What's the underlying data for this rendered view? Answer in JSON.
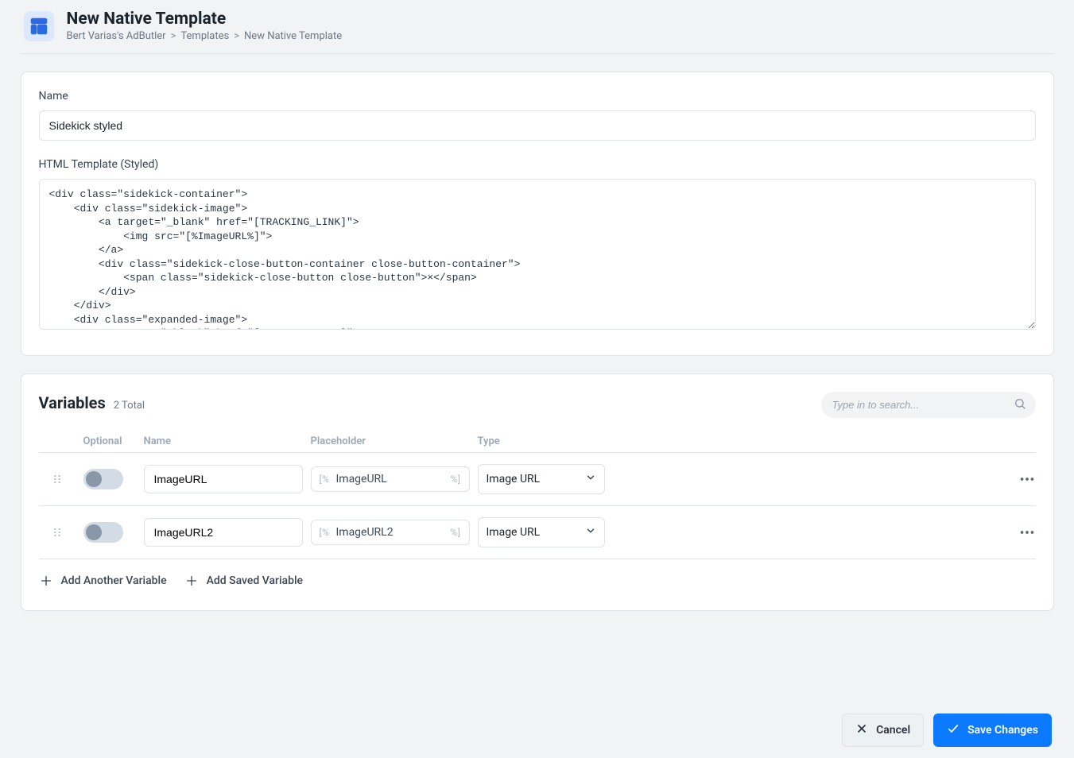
{
  "header": {
    "title": "New Native Template",
    "icon": "template-icon",
    "breadcrumb": [
      "Bert Varias's AdButler",
      "Templates",
      "New Native Template"
    ]
  },
  "form": {
    "name_label": "Name",
    "name_value": "Sidekick styled",
    "html_label": "HTML Template (Styled)",
    "html_value": "<div class=\"sidekick-container\">\n    <div class=\"sidekick-image\">\n        <a target=\"_blank\" href=\"[TRACKING_LINK]\">\n            <img src=\"[%ImageURL%]\">\n        </a>\n        <div class=\"sidekick-close-button-container close-button-container\">\n            <span class=\"sidekick-close-button close-button\">×</span>\n        </div>\n    </div>\n    <div class=\"expanded-image\">\n        <a target=\"_blank\" href=\"[TRACKING_LINK]\">"
  },
  "variables": {
    "title": "Variables",
    "total_label": "2 Total",
    "search_placeholder": "Type in to search...",
    "columns": {
      "optional": "Optional",
      "name": "Name",
      "placeholder": "Placeholder",
      "type": "Type"
    },
    "placeholder_pre": "[%",
    "placeholder_post": "%]",
    "rows": [
      {
        "name": "ImageURL",
        "placeholder": "ImageURL",
        "type": "Image URL",
        "optional": false
      },
      {
        "name": "ImageURL2",
        "placeholder": "ImageURL2",
        "type": "Image URL",
        "optional": false
      }
    ],
    "add_variable_label": "Add Another Variable",
    "add_saved_label": "Add Saved Variable"
  },
  "footer": {
    "cancel": "Cancel",
    "save": "Save Changes"
  }
}
